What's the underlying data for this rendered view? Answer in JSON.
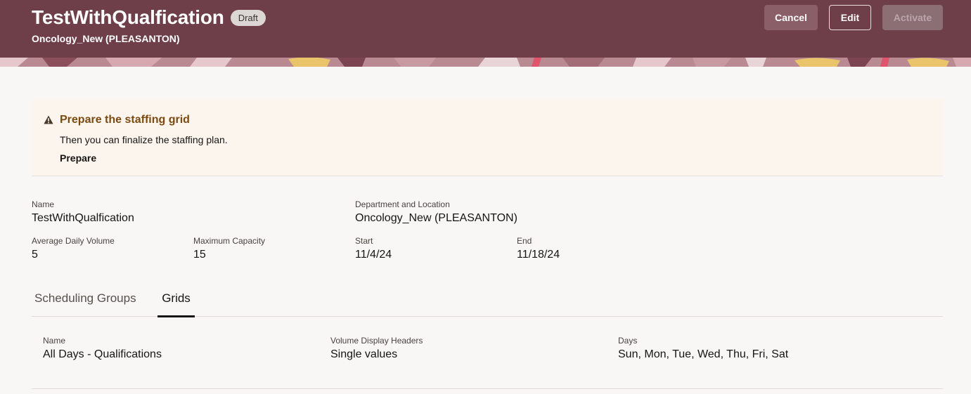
{
  "header": {
    "title": "TestWithQualfication",
    "status": "Draft",
    "subtitle": "Oncology_New (PLEASANTON)",
    "cancel_label": "Cancel",
    "edit_label": "Edit",
    "activate_label": "Activate",
    "colors": {
      "background": "#6e3f49",
      "band_accent_yellow": "#e9c46a",
      "band_accent_pink": "#d98a9c"
    }
  },
  "banner": {
    "icon": "warning-icon",
    "title": "Prepare the staffing grid",
    "text": "Then you can finalize the staffing plan.",
    "link": "Prepare",
    "color": "#7a4a10"
  },
  "details": {
    "name": {
      "label": "Name",
      "value": "TestWithQualfication"
    },
    "department": {
      "label": "Department and Location",
      "value": "Oncology_New (PLEASANTON)"
    },
    "avg_volume": {
      "label": "Average Daily Volume",
      "value": "5"
    },
    "max_capacity": {
      "label": "Maximum Capacity",
      "value": "15"
    },
    "start": {
      "label": "Start",
      "value": "11/4/24"
    },
    "end": {
      "label": "End",
      "value": "11/18/24"
    }
  },
  "tabs": [
    {
      "label": "Scheduling Groups",
      "selected": false
    },
    {
      "label": "Grids",
      "selected": true
    }
  ],
  "grid": {
    "name": {
      "label": "Name",
      "value": "All Days - Qualifications"
    },
    "volume_headers": {
      "label": "Volume Display Headers",
      "value": "Single values"
    },
    "days": {
      "label": "Days",
      "value": "Sun, Mon, Tue, Wed, Thu, Fri, Sat"
    }
  }
}
